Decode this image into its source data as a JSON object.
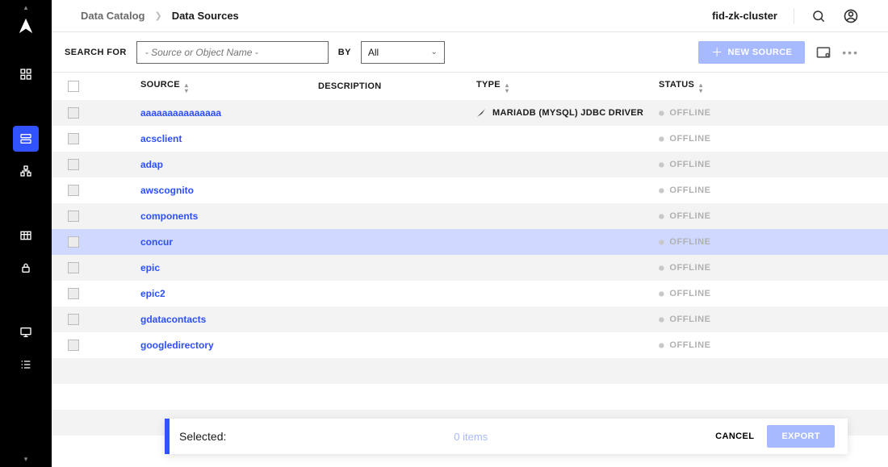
{
  "breadcrumb": {
    "parent": "Data Catalog",
    "current": "Data Sources"
  },
  "header": {
    "cluster": "fid-zk-cluster"
  },
  "filter": {
    "search_for_label": "SEARCH FOR",
    "search_placeholder": "- Source or Object Name -",
    "by_label": "BY",
    "by_value": "All",
    "new_source_label": "NEW SOURCE"
  },
  "columns": {
    "source": "SOURCE",
    "description": "DESCRIPTION",
    "type": "TYPE",
    "status": "STATUS"
  },
  "rows": [
    {
      "source": "aaaaaaaaaaaaaaa",
      "description": "",
      "type": "MARIADB (MYSQL) JDBC DRIVER",
      "type_icon": true,
      "status": "OFFLINE",
      "highlight": false
    },
    {
      "source": "acsclient",
      "description": "",
      "type": "",
      "type_icon": false,
      "status": "OFFLINE",
      "highlight": false
    },
    {
      "source": "adap",
      "description": "",
      "type": "",
      "type_icon": false,
      "status": "OFFLINE",
      "highlight": false
    },
    {
      "source": "awscognito",
      "description": "",
      "type": "",
      "type_icon": false,
      "status": "OFFLINE",
      "highlight": false
    },
    {
      "source": "components",
      "description": "",
      "type": "",
      "type_icon": false,
      "status": "OFFLINE",
      "highlight": false
    },
    {
      "source": "concur",
      "description": "",
      "type": "",
      "type_icon": false,
      "status": "OFFLINE",
      "highlight": true
    },
    {
      "source": "epic",
      "description": "",
      "type": "",
      "type_icon": false,
      "status": "OFFLINE",
      "highlight": false
    },
    {
      "source": "epic2",
      "description": "",
      "type": "",
      "type_icon": false,
      "status": "OFFLINE",
      "highlight": false
    },
    {
      "source": "gdatacontacts",
      "description": "",
      "type": "",
      "type_icon": false,
      "status": "OFFLINE",
      "highlight": false
    },
    {
      "source": "googledirectory",
      "description": "",
      "type": "",
      "type_icon": false,
      "status": "OFFLINE",
      "highlight": false
    }
  ],
  "footer": {
    "selected_label": "Selected:",
    "count_text": "0 items",
    "cancel": "CANCEL",
    "export": "EXPORT"
  }
}
